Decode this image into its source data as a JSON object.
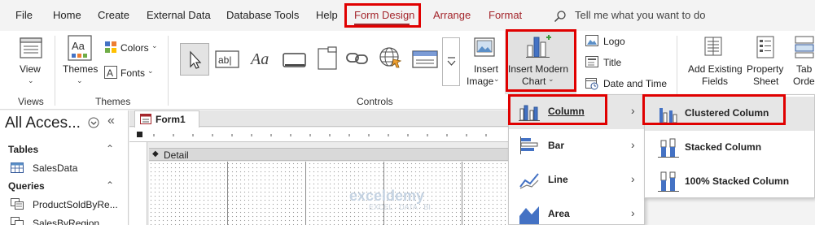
{
  "menubar": {
    "items": [
      "File",
      "Home",
      "Create",
      "External Data",
      "Database Tools",
      "Help",
      "Form Design",
      "Arrange",
      "Format"
    ],
    "active": "Form Design",
    "tell_me": "Tell me what you want to do"
  },
  "ribbon": {
    "views": {
      "view_label": "View",
      "group": "Views"
    },
    "themes": {
      "themes_label": "Themes",
      "colors_label": "Colors",
      "fonts_label": "Fonts",
      "group": "Themes"
    },
    "controls": {
      "group": "Controls",
      "gallery_text_box": "ab|",
      "gallery_label": "Aa"
    },
    "insert_image": {
      "line1": "Insert",
      "line2": "Image"
    },
    "insert_chart": {
      "line1": "Insert Modern",
      "line2": "Chart"
    },
    "header_footer": {
      "logo": "Logo",
      "title": "Title",
      "date_time": "Date and Time"
    },
    "tools": {
      "add_existing_1": "Add Existing",
      "add_existing_2": "Fields",
      "property_1": "Property",
      "property_2": "Sheet",
      "tab_1": "Tab",
      "tab_2": "Order"
    }
  },
  "nav": {
    "title": "All Acces...",
    "sections": [
      {
        "label": "Tables",
        "items": [
          "SalesData"
        ]
      },
      {
        "label": "Queries",
        "items": [
          "ProductSoldByRe...",
          "SalesByRegion"
        ]
      }
    ]
  },
  "form": {
    "tab": "Form1",
    "section": "Detail",
    "watermark": "exceldemy",
    "watermark_sub": "EXCEL · DATA · BI"
  },
  "chart_menu": {
    "items": [
      "Column",
      "Bar",
      "Line",
      "Area"
    ],
    "highlighted": "Column"
  },
  "column_submenu": {
    "items": [
      "Clustered Column",
      "Stacked Column",
      "100% Stacked Column"
    ],
    "highlighted": "Clustered Column"
  },
  "colors": {
    "accent": "#a4262c",
    "highlight_box": "#e00000",
    "chart_blue": "#4472c4"
  }
}
